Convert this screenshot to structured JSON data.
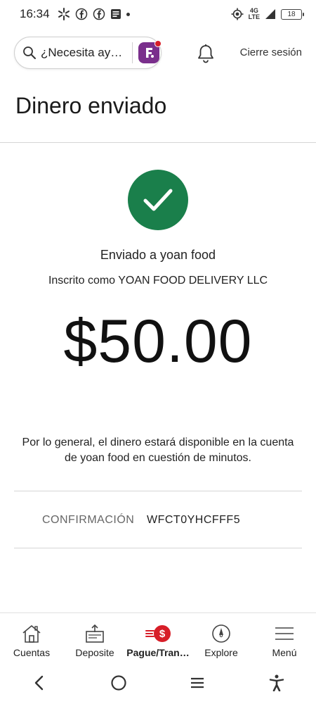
{
  "status_bar": {
    "time": "16:34",
    "battery": "18",
    "network": "4G",
    "network_sub": "LTE"
  },
  "header": {
    "search_placeholder": "¿Necesita ay…",
    "sign_out": "Cierre sesión"
  },
  "page": {
    "title": "Dinero enviado"
  },
  "success": {
    "sent_to": "Enviado a yoan food",
    "enrolled_as": "Inscrito como YOAN FOOD DELIVERY LLC",
    "amount": "$50.00",
    "availability_note": "Por lo general, el dinero estará disponible en la cuenta de yoan food en cuestión de minutos."
  },
  "confirmation": {
    "label": "CONFIRMACIÓN",
    "value": "WFCT0YHCFFF5"
  },
  "bottom_nav": {
    "items": [
      {
        "label": "Cuentas",
        "icon": "house-icon"
      },
      {
        "label": "Deposite",
        "icon": "deposit-icon"
      },
      {
        "label": "Pague/Tran…",
        "icon": "pay-transfer-icon",
        "active": true
      },
      {
        "label": "Explore",
        "icon": "compass-icon"
      },
      {
        "label": "Menú",
        "icon": "hamburger-icon"
      }
    ]
  },
  "colors": {
    "success_green": "#1a7f4b",
    "brand_red": "#d71e28",
    "brand_purple": "#7a2f8c"
  }
}
